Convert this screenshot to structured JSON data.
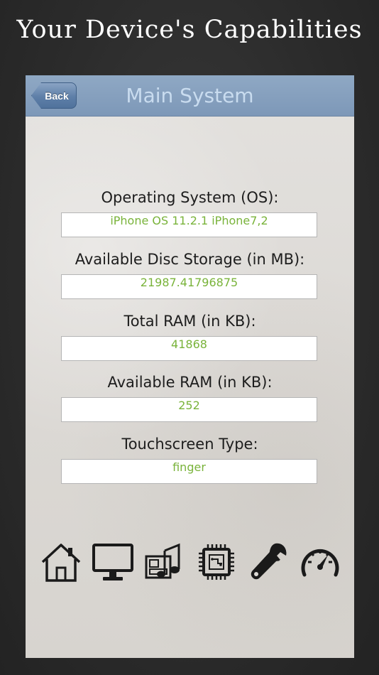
{
  "headline": "Your Device's Capabilities",
  "navbar": {
    "back_label": "Back",
    "title": "Main System"
  },
  "fields": [
    {
      "label": "Operating System (OS):",
      "value": "iPhone OS 11.2.1 iPhone7,2"
    },
    {
      "label": "Available Disc Storage (in MB):",
      "value": "21987.41796875"
    },
    {
      "label": "Total RAM (in KB):",
      "value": "41868"
    },
    {
      "label": "Available RAM (in KB):",
      "value": "252"
    },
    {
      "label": "Touchscreen Type:",
      "value": "finger"
    }
  ],
  "toolbar": {
    "icons": [
      "home-icon",
      "monitor-icon",
      "media-icon",
      "chip-icon",
      "wrench-icon",
      "speedometer-icon"
    ]
  },
  "colors": {
    "navbar": "#8fa8c4",
    "nav_title": "#c9dcef",
    "value_text": "#79b33a"
  }
}
